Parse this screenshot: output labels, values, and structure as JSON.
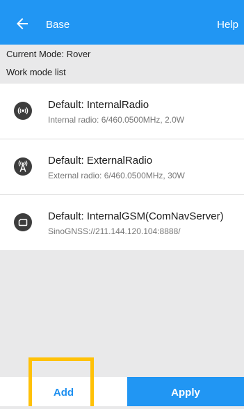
{
  "header": {
    "title": "Base",
    "help_label": "Help",
    "back_icon": "arrow-left-icon",
    "bg_color": "#2196f3"
  },
  "info": {
    "current_mode": "Current Mode:  Rover",
    "section_label": "Work mode list"
  },
  "work_modes": [
    {
      "title": "Default: InternalRadio",
      "subtitle": "Internal radio: 6/460.0500MHz, 2.0W",
      "icon": "radio-waves-icon"
    },
    {
      "title": "Default: ExternalRadio",
      "subtitle": "External radio: 6/460.0500MHz, 30W",
      "icon": "antenna-tower-icon"
    },
    {
      "title": "Default: InternalGSM(ComNavServer)",
      "subtitle": "SinoGNSS://211.144.120.104:8888/",
      "icon": "sim-card-icon"
    }
  ],
  "footer": {
    "add_label": "Add",
    "apply_label": "Apply",
    "highlight_color": "#ffc107"
  }
}
